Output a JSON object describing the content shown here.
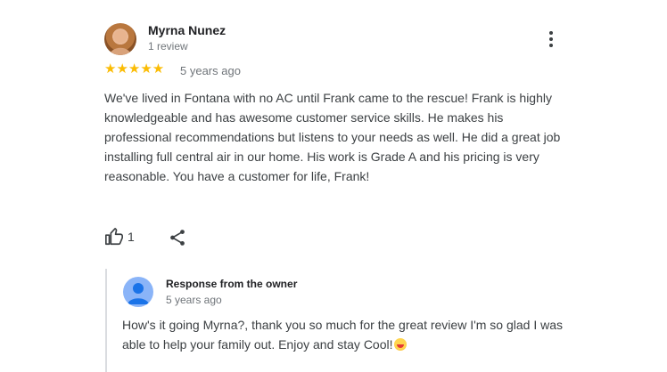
{
  "review": {
    "reviewer_name": "Myrna Nunez",
    "review_count": "1 review",
    "rating": 5,
    "stars": "★★★★★",
    "time": "5 years ago",
    "text": "We've lived in Fontana with no AC until Frank came to the rescue! Frank is highly knowledgeable and has awesome customer service skills. He makes his professional recommendations but listens to your needs as well. He did a great job installing full central air in our home. His work is Grade A and his pricing is very reasonable. You have a customer for life, Frank!",
    "like_count": "1",
    "icons": [
      "more-vert-icon",
      "thumb-up-icon",
      "share-icon"
    ],
    "star_color": "#fbbc04"
  },
  "owner_response": {
    "title": "Response from the owner",
    "time": "5 years ago",
    "text": "How's it going Myrna?, thank you so much for the great review I'm so glad I was able to help your family out. Enjoy and stay Cool!",
    "emoji_icon": "grinning-face-icon",
    "avatar_color": "#8ab4f8"
  }
}
